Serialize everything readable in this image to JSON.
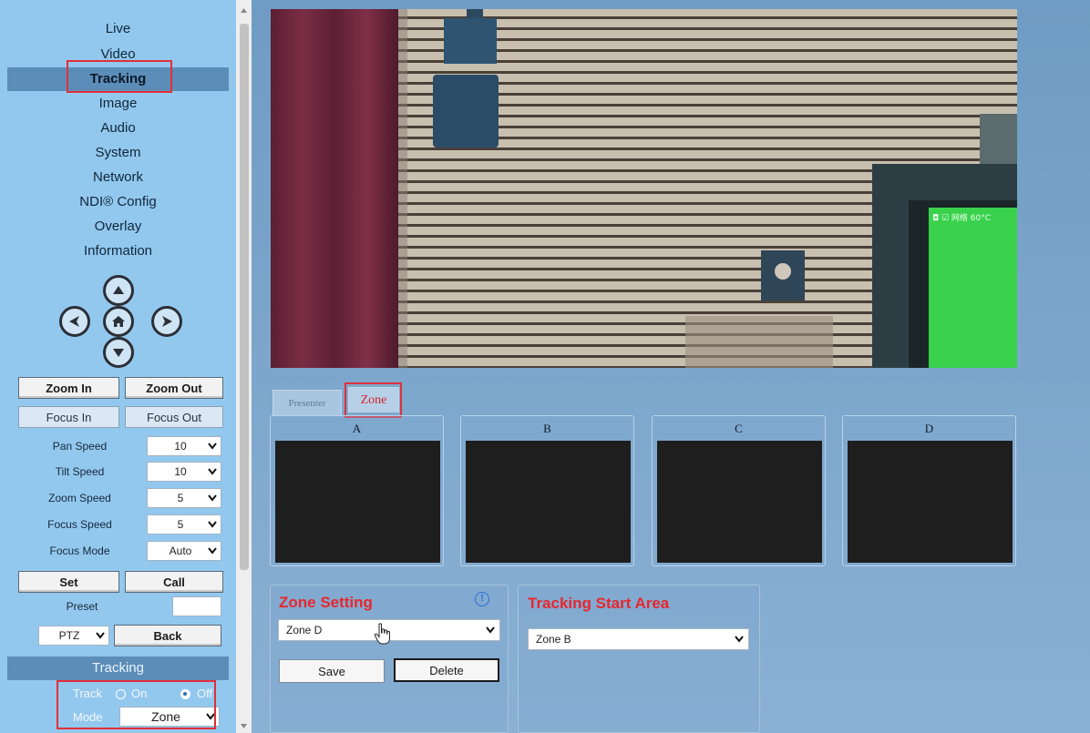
{
  "sidebar": {
    "nav": [
      {
        "label": "Live",
        "name": "nav-live"
      },
      {
        "label": "Video",
        "name": "nav-video"
      },
      {
        "label": "Tracking",
        "name": "nav-tracking"
      },
      {
        "label": "Image",
        "name": "nav-image"
      },
      {
        "label": "Audio",
        "name": "nav-audio"
      },
      {
        "label": "System",
        "name": "nav-system"
      },
      {
        "label": "Network",
        "name": "nav-network"
      },
      {
        "label": "NDI® Config",
        "name": "nav-ndi-config"
      },
      {
        "label": "Overlay",
        "name": "nav-overlay"
      },
      {
        "label": "Information",
        "name": "nav-information"
      }
    ],
    "active_nav": "Tracking",
    "ptz": {
      "zoom_in": "Zoom In",
      "zoom_out": "Zoom Out",
      "focus_in": "Focus In",
      "focus_out": "Focus Out",
      "params": [
        {
          "label": "Pan Speed",
          "value": "10"
        },
        {
          "label": "Tilt Speed",
          "value": "10"
        },
        {
          "label": "Zoom Speed",
          "value": "5"
        },
        {
          "label": "Focus Speed",
          "value": "5"
        },
        {
          "label": "Focus Mode",
          "value": "Auto"
        }
      ],
      "set": "Set",
      "call": "Call",
      "preset_label": "Preset",
      "preset_value": "",
      "mode_select": "PTZ",
      "back": "Back"
    },
    "tracking": {
      "header": "Tracking",
      "track_label": "Track",
      "on_label": "On",
      "off_label": "Off",
      "track_state": "Off",
      "mode_label": "Mode",
      "mode_value": "Zone"
    }
  },
  "main": {
    "tabs": [
      {
        "label": "Presenter",
        "active": false
      },
      {
        "label": "Zone",
        "active": true
      }
    ],
    "zones": [
      "A",
      "B",
      "C",
      "D"
    ],
    "zone_setting": {
      "title": "Zone Setting",
      "info_icon": "!",
      "selected": "Zone D",
      "save": "Save",
      "delete": "Delete"
    },
    "tracking_start_area": {
      "title": "Tracking Start Area",
      "selected": "Zone B"
    }
  },
  "video": {
    "overlay_text": "◘ ☑ 网络 60°C"
  },
  "colors": {
    "sidebar_bg": "#93c8ee",
    "nav_active": "#5c8db8",
    "highlight_red": "#e0303a",
    "title_red": "#e8262e",
    "main_bg": "#7aa4ca"
  }
}
